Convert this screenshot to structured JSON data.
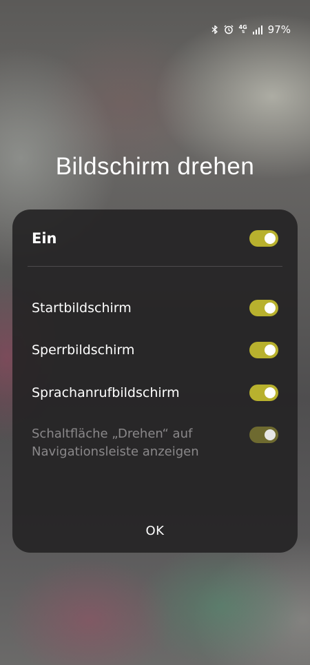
{
  "status_bar": {
    "icons": [
      "bluetooth-icon",
      "alarm-icon",
      "4g-icon",
      "signal-icon"
    ],
    "network_label": "4G",
    "battery": "97%"
  },
  "title": "Bildschirm drehen",
  "dialog": {
    "master": {
      "label": "Ein",
      "enabled": true
    },
    "options": [
      {
        "label": "Startbildschirm",
        "enabled": true,
        "disabled": false
      },
      {
        "label": "Sperrbildschirm",
        "enabled": true,
        "disabled": false
      },
      {
        "label": "Sprachanrufbildschirm",
        "enabled": true,
        "disabled": false
      },
      {
        "label": "Schaltfläche „Drehen“ auf Navigationsleiste anzeigen",
        "enabled": true,
        "disabled": true
      }
    ],
    "ok_label": "OK"
  },
  "colors": {
    "switch_on": "#b8b12e",
    "switch_on_disabled": "#6e6a30",
    "dialog_bg": "#242224",
    "disabled_text": "#8a888a"
  }
}
